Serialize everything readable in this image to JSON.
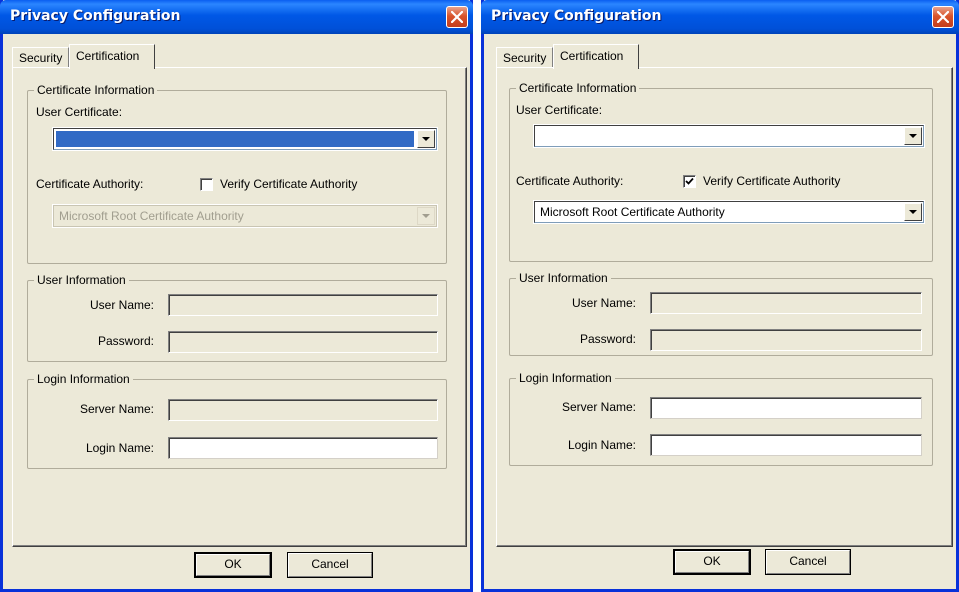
{
  "left_dialog": {
    "title": "Privacy Configuration",
    "tabs": [
      {
        "label": "Security"
      },
      {
        "label": "Certification"
      }
    ],
    "certificate_information": {
      "legend": "Certificate Information",
      "user_certificate_label": "User Certificate:",
      "user_certificate_value": "",
      "certificate_authority_label": "Certificate Authority:",
      "verify_label": "Verify Certificate Authority",
      "verify_checked": false,
      "authority_value": "Microsoft Root Certificate Authority"
    },
    "user_information": {
      "legend": "User Information",
      "user_name_label": "User Name:",
      "password_label": "Password:"
    },
    "login_information": {
      "legend": "Login Information",
      "server_name_label": "Server Name:",
      "login_name_label": "Login Name:"
    },
    "ok_label": "OK",
    "cancel_label": "Cancel"
  },
  "right_dialog": {
    "title": "Privacy Configuration",
    "tabs": [
      {
        "label": "Security"
      },
      {
        "label": "Certification"
      }
    ],
    "certificate_information": {
      "legend": "Certificate Information",
      "user_certificate_label": "User Certificate:",
      "user_certificate_value": "",
      "certificate_authority_label": "Certificate Authority:",
      "verify_label": "Verify Certificate Authority",
      "verify_checked": true,
      "authority_value": "Microsoft Root Certificate Authority"
    },
    "user_information": {
      "legend": "User Information",
      "user_name_label": "User Name:",
      "password_label": "Password:"
    },
    "login_information": {
      "legend": "Login Information",
      "server_name_label": "Server Name:",
      "login_name_label": "Login Name:"
    },
    "ok_label": "OK",
    "cancel_label": "Cancel"
  },
  "colors": {
    "titlebar": "#0058e6",
    "window_face": "#ece9d8",
    "selection": "#316ac5",
    "close_button": "#d9542b"
  }
}
